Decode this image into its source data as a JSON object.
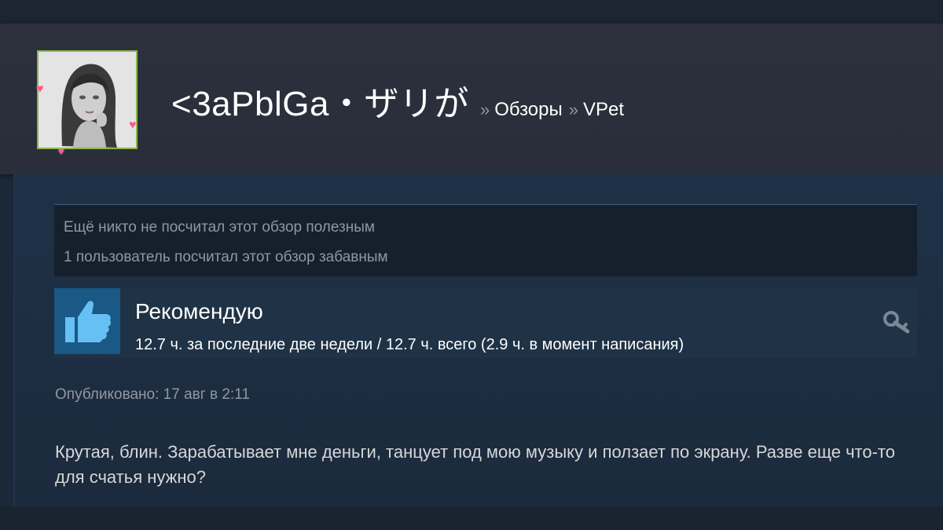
{
  "header": {
    "persona_name": "<3aPblGa・ザリが",
    "breadcrumb_sep": "»",
    "crumb_reviews": "Обзоры",
    "crumb_game": "VPet"
  },
  "ratings": {
    "helpful": "Ещё никто не посчитал этот обзор полезным",
    "funny": "1 пользователь посчитал этот обзор забавным"
  },
  "review": {
    "recommendation": "Рекомендую",
    "hours": "12.7 ч. за последние две недели / 12.7 ч. всего (2.9 ч. в момент написания)",
    "posted": "Опубликовано: 17 авг в 2:11",
    "text": "Крутая, блин. Зарабатывает мне деньги, танцует под мою музыку и ползает по экрану. Разве еще что-то для счатья нужно?"
  },
  "icons": {
    "thumb": "thumbs-up-icon",
    "key": "key-icon",
    "heart": "heart-icon"
  },
  "colors": {
    "background": "#1b2838",
    "header": "#2a2e3a",
    "thumb_bg": "#1a5886",
    "thumb_fg": "#66c0f4",
    "avatar_border": "#8ab54a",
    "muted_text": "#8f98a0",
    "heart": "#ff5a93"
  }
}
